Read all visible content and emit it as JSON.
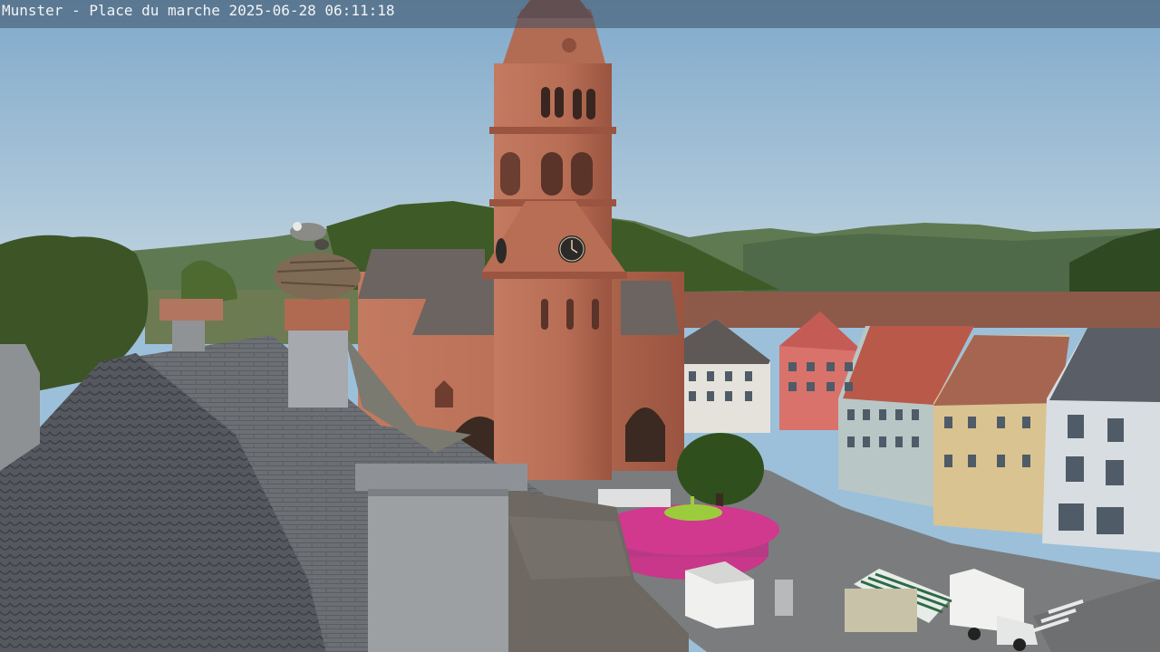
{
  "webcam": {
    "caption": "Munster - Place du marche 2025-06-28 06:11:18"
  },
  "colors": {
    "sky_top": "#87b0cf",
    "sky_bottom": "#b9d0de",
    "sandstone": "#b8705a",
    "sandstone_dark": "#8f4f3d",
    "roof_slate": "#5b5e63",
    "forest": "#3f5d2a",
    "kiosk_pink": "#d1398f"
  }
}
